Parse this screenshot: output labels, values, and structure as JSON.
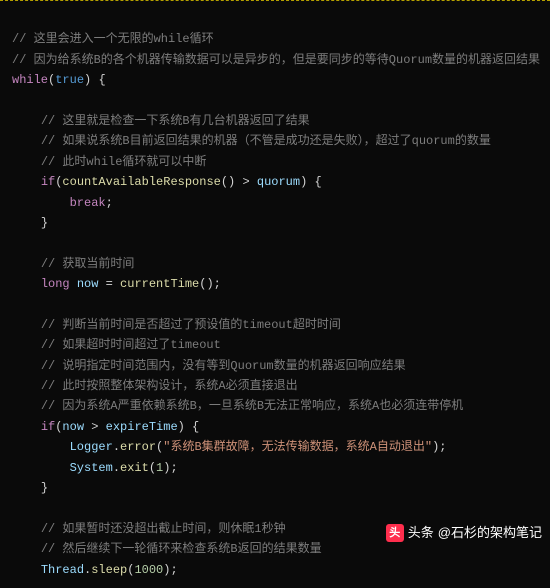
{
  "hr": "",
  "lines": {
    "c1": "// 这里会进入一个无限的while循环",
    "c2": "// 因为给系统B的各个机器传输数据可以是异步的，但是要同步的等待Quorum数量的机器返回结果",
    "kw_while": "while",
    "bool_true": "true",
    "brace_open": "{",
    "c3": "// 这里就是检查一下系统B有几台机器返回了结果",
    "c4": "// 如果说系统B目前返回结果的机器（不管是成功还是失败），超过了quorum的数量",
    "c5": "// 此时while循环就可以中断",
    "kw_if1": "if",
    "fn_count": "countAvailableResponse",
    "op_gt1": ">",
    "var_quorum": "quorum",
    "kw_break": "break",
    "brace_close1": "}",
    "c6": "// 获取当前时间",
    "type_long": "long",
    "var_now": "now",
    "op_eq": "=",
    "fn_time": "currentTime",
    "c7": "// 判断当前时间是否超过了预设值的timeout超时时间",
    "c8": "// 如果超时时间超过了timeout",
    "c9": "// 说明指定时间范围内，没有等到Quorum数量的机器返回响应结果",
    "c10": "// 此时按照整体架构设计，系统A必须直接退出",
    "c11": "// 因为系统A严重依赖系统B，一旦系统B无法正常响应，系统A也必须连带停机",
    "kw_if2": "if",
    "var_now2": "now",
    "op_gt2": ">",
    "var_expire": "expireTime",
    "cls_logger": "Logger",
    "fn_error": "error",
    "str_err": "\"系统B集群故障，无法传输数据，系统A自动退出\"",
    "cls_system": "System",
    "fn_exit": "exit",
    "num_1": "1",
    "brace_close2": "}",
    "c12": "// 如果暂时还没超出截止时间，则休眠1秒钟",
    "c13": "// 然后继续下一轮循环来检查系统B返回的结果数量",
    "cls_thread": "Thread",
    "fn_sleep": "sleep",
    "num_1000": "1000"
  },
  "watermark": {
    "label": "头条",
    "author": "@石杉的架构笔记"
  }
}
